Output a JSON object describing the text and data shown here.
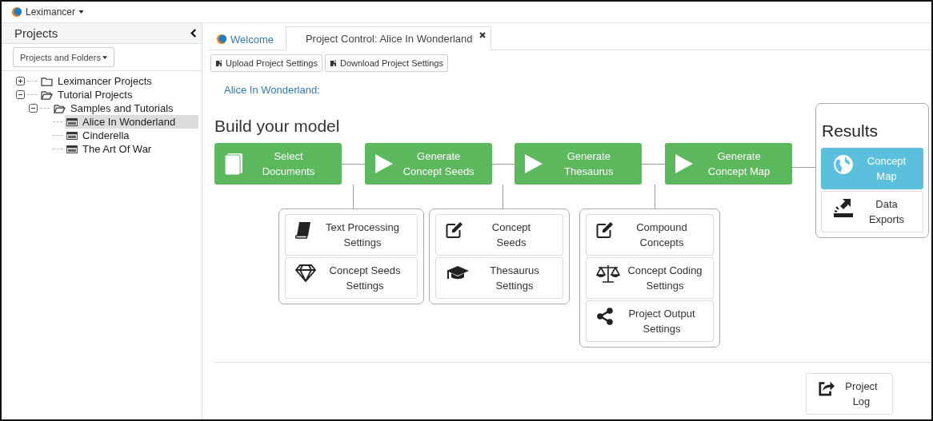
{
  "app_menu": {
    "label": "Leximancer"
  },
  "sidebar": {
    "title": "Projects",
    "view_dropdown": "Projects and Folders",
    "tree": [
      {
        "label": "Leximancer Projects",
        "kind": "folder",
        "expanded": false,
        "selected": false
      },
      {
        "label": "Tutorial Projects",
        "kind": "folder",
        "expanded": true,
        "selected": false,
        "children": [
          {
            "label": "Samples and Tutorials",
            "kind": "folder",
            "expanded": true,
            "selected": false,
            "children": [
              {
                "label": "Alice In Wonderland",
                "kind": "project",
                "selected": true
              },
              {
                "label": "Cinderella",
                "kind": "project",
                "selected": false
              },
              {
                "label": "The Art Of War",
                "kind": "project",
                "selected": false
              }
            ]
          }
        ]
      }
    ]
  },
  "tabs": [
    {
      "label": "Welcome",
      "kind": "welcome",
      "selected": false,
      "closable": false
    },
    {
      "label": "Project Control: Alice In Wonderland",
      "kind": "project",
      "selected": true,
      "closable": true
    }
  ],
  "toolbar": [
    "Upload Project Settings",
    "Download Project Settings"
  ],
  "project_link": "Alice In Wonderland:",
  "build": {
    "title": "Build your model",
    "steps": [
      {
        "label": "Select\nDocuments",
        "kind": "documents"
      },
      {
        "label": "Generate\nConcept Seeds",
        "kind": "play",
        "settings": [
          {
            "label": "Text Processing\nSettings",
            "kind": "book"
          },
          {
            "label": "Concept Seeds\nSettings",
            "kind": "diamond"
          }
        ]
      },
      {
        "label": "Generate\nThesaurus",
        "kind": "play",
        "settings": [
          {
            "label": "Concept\nSeeds",
            "kind": "edit"
          },
          {
            "label": "Thesaurus\nSettings",
            "kind": "cap"
          }
        ]
      },
      {
        "label": "Generate\nConcept Map",
        "kind": "play",
        "settings": [
          {
            "label": "Compound\nConcepts",
            "kind": "edit"
          },
          {
            "label": "Concept Coding\nSettings",
            "kind": "scale"
          },
          {
            "label": "Project Output\nSettings",
            "kind": "share"
          }
        ]
      }
    ]
  },
  "results": {
    "title": "Results",
    "items": [
      {
        "label": "Concept\nMap",
        "kind": "globe",
        "selected": true
      },
      {
        "label": "Data\nExports",
        "kind": "export",
        "selected": false
      }
    ]
  },
  "project_log": "Project\nLog"
}
